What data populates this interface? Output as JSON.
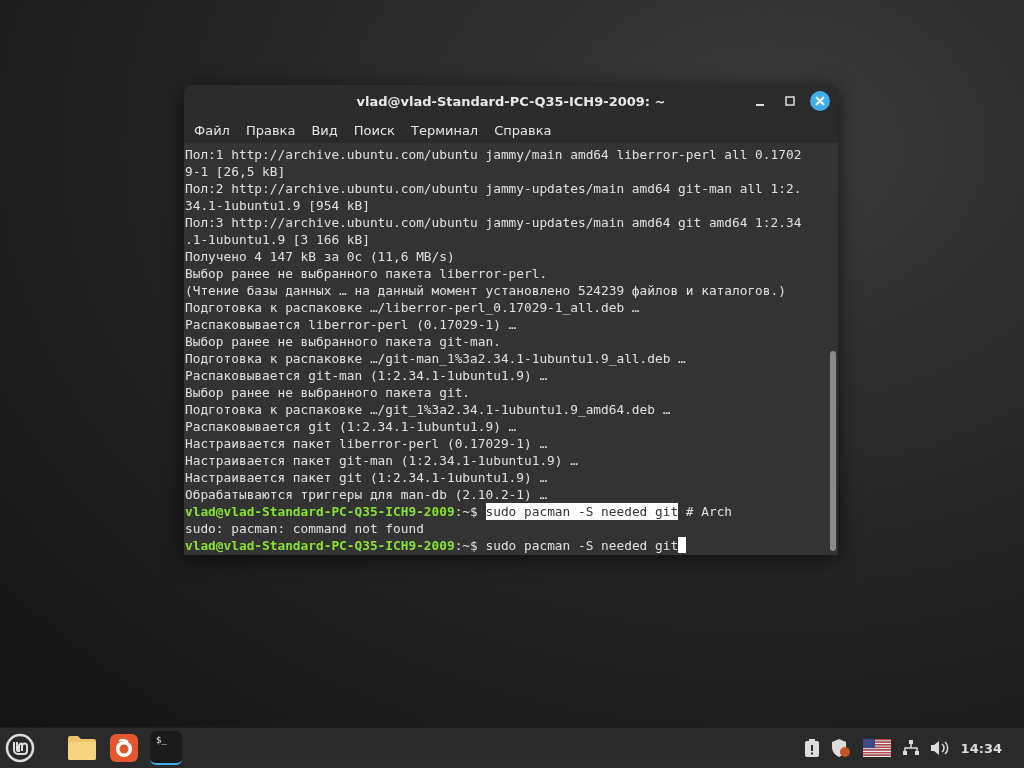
{
  "window": {
    "title": "vlad@vlad-Standard-PC-Q35-ICH9-2009: ~"
  },
  "menu": [
    "Файл",
    "Правка",
    "Вид",
    "Поиск",
    "Терминал",
    "Справка"
  ],
  "terminal_lines": [
    {
      "kind": "output",
      "text": "Пол:1 http://archive.ubuntu.com/ubuntu jammy/main amd64 liberror-perl all 0.1702"
    },
    {
      "kind": "output",
      "text": "9-1 [26,5 kB]"
    },
    {
      "kind": "output",
      "text": "Пол:2 http://archive.ubuntu.com/ubuntu jammy-updates/main amd64 git-man all 1:2."
    },
    {
      "kind": "output",
      "text": "34.1-1ubuntu1.9 [954 kB]"
    },
    {
      "kind": "output",
      "text": "Пол:3 http://archive.ubuntu.com/ubuntu jammy-updates/main amd64 git amd64 1:2.34"
    },
    {
      "kind": "output",
      "text": ".1-1ubuntu1.9 [3 166 kB]"
    },
    {
      "kind": "output",
      "text": "Получено 4 147 kB за 0c (11,6 MB/s)"
    },
    {
      "kind": "output",
      "text": "Выбор ранее не выбранного пакета liberror-perl."
    },
    {
      "kind": "output",
      "text": "(Чтение базы данных … на данный момент установлено 524239 файлов и каталогов.)"
    },
    {
      "kind": "output",
      "text": "Подготовка к распаковке …/liberror-perl_0.17029-1_all.deb …"
    },
    {
      "kind": "output",
      "text": "Распаковывается liberror-perl (0.17029-1) …"
    },
    {
      "kind": "output",
      "text": "Выбор ранее не выбранного пакета git-man."
    },
    {
      "kind": "output",
      "text": "Подготовка к распаковке …/git-man_1%3a2.34.1-1ubuntu1.9_all.deb …"
    },
    {
      "kind": "output",
      "text": "Распаковывается git-man (1:2.34.1-1ubuntu1.9) …"
    },
    {
      "kind": "output",
      "text": "Выбор ранее не выбранного пакета git."
    },
    {
      "kind": "output",
      "text": "Подготовка к распаковке …/git_1%3a2.34.1-1ubuntu1.9_amd64.deb …"
    },
    {
      "kind": "output",
      "text": "Распаковывается git (1:2.34.1-1ubuntu1.9) …"
    },
    {
      "kind": "output",
      "text": "Настраивается пакет liberror-perl (0.17029-1) …"
    },
    {
      "kind": "output",
      "text": "Настраивается пакет git-man (1:2.34.1-1ubuntu1.9) …"
    },
    {
      "kind": "output",
      "text": "Настраивается пакет git (1:2.34.1-1ubuntu1.9) …"
    },
    {
      "kind": "output",
      "text": "Обрабатываются триггеры для man-db (2.10.2-1) …"
    },
    {
      "kind": "prompt",
      "user": "vlad@vlad-Standard-PC-Q35-ICH9-2009",
      "path": ":~$",
      "command": "sudo pacman -S needed git",
      "comment": "# Arch",
      "selected": true,
      "cursor": false
    },
    {
      "kind": "output",
      "text": "sudo: pacman: command not found"
    },
    {
      "kind": "prompt",
      "user": "vlad@vlad-Standard-PC-Q35-ICH9-2009",
      "path": ":~$",
      "command": "sudo pacman -S needed git",
      "selected": false,
      "cursor": true
    }
  ],
  "taskbar": {
    "terminal_glyph": "$_",
    "clock": "14:34"
  }
}
